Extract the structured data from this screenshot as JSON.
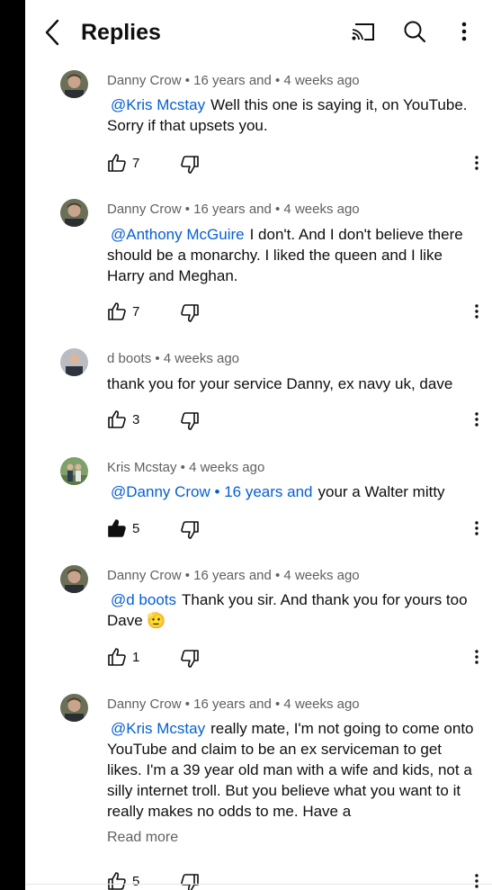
{
  "header": {
    "title": "Replies",
    "back_icon": "chevron-left-icon",
    "cast_icon": "cast-icon",
    "search_icon": "search-icon",
    "menu_icon": "more-vert-icon"
  },
  "comments": [
    {
      "author": "Danny Crow",
      "meta": "Danny Crow • 16 years and  • 4 weeks ago",
      "mention": "@Kris Mcstay",
      "text": "Well this one is saying it, on YouTube. Sorry if that upsets you.",
      "likes": "7",
      "liked": false
    },
    {
      "author": "Danny Crow",
      "meta": "Danny Crow • 16 years and  • 4 weeks ago",
      "mention": "@Anthony McGuire",
      "text": "I don't. And I don't believe there should be a monarchy. I liked the queen and I like Harry and Meghan.",
      "likes": "7",
      "liked": false
    },
    {
      "author": "d boots",
      "meta": "d boots • 4 weeks ago",
      "mention": "",
      "text": "thank you for your service Danny, ex navy uk, dave",
      "likes": "3",
      "liked": false
    },
    {
      "author": "Kris Mcstay",
      "meta": "Kris Mcstay • 4 weeks ago",
      "mention": "@Danny Crow • 16 years and",
      "text": "your a Walter mitty",
      "likes": "5",
      "liked": true
    },
    {
      "author": "Danny Crow",
      "meta": "Danny Crow • 16 years and  • 4 weeks ago",
      "mention": "@d boots",
      "text": "Thank you sir. And thank you for yours too Dave 🫡",
      "likes": "1",
      "liked": false
    },
    {
      "author": "Danny Crow",
      "meta": "Danny Crow • 16 years and  • 4 weeks ago",
      "mention": "@Kris Mcstay",
      "text": "really mate, I'm not going to come onto YouTube and claim to be an ex serviceman to get likes. I'm a 39 year old man with a wife and kids, not a silly internet troll. But you believe what you want to it really makes no odds to me. Have a",
      "read_more": "Read more",
      "likes": "5",
      "liked": false
    }
  ],
  "colors": {
    "mention": "#065fd4",
    "meta": "#606060",
    "text": "#0f0f0f"
  }
}
